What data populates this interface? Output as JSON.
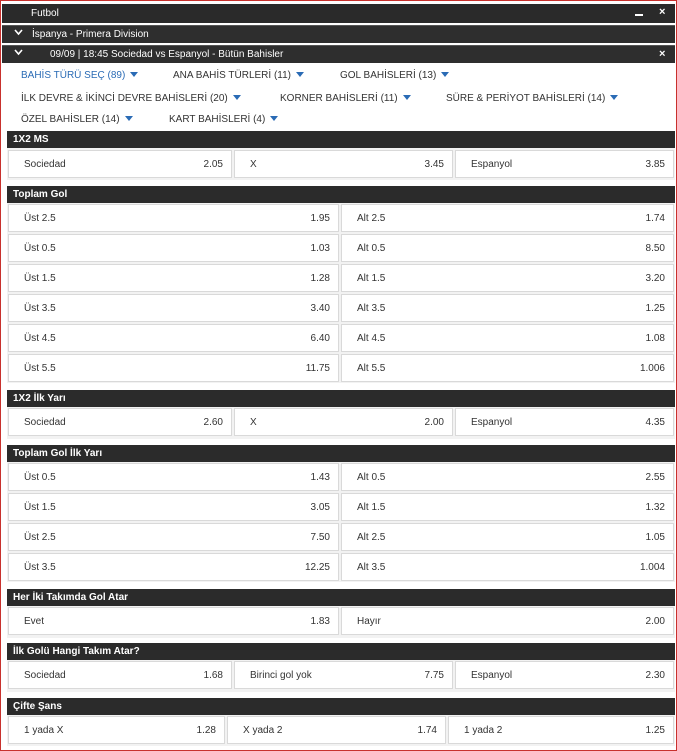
{
  "topbar": {
    "title": "Futbol",
    "minimize": "−",
    "close": "×"
  },
  "league": {
    "label": "İspanya - Primera Division"
  },
  "match": {
    "label": "09/09 | 18:45 Sociedad vs Espanyol - Bütün Bahisler",
    "close": "×"
  },
  "tabs": [
    {
      "label": "BAHİS TÜRÜ SEÇ (89)",
      "active": true
    },
    {
      "label": "ANA BAHİS TÜRLERİ (11)"
    },
    {
      "label": "GOL BAHİSLERİ (13)"
    },
    {
      "label": "İLK DEVRE & İKİNCİ DEVRE BAHİSLERİ (20)"
    },
    {
      "label": "KORNER BAHİSLERİ (11)"
    },
    {
      "label": "SÜRE & PERİYOT BAHİSLERİ (14)"
    },
    {
      "label": "ÖZEL BAHİSLER (14)"
    },
    {
      "label": "KART BAHİSLERİ (4)"
    }
  ],
  "sections": {
    "ms": {
      "title": "1X2 MS",
      "cells": [
        {
          "label": "Sociedad",
          "odd": "2.05"
        },
        {
          "label": "X",
          "odd": "3.45"
        },
        {
          "label": "Espanyol",
          "odd": "3.85"
        }
      ]
    },
    "toplam": {
      "title": "Toplam Gol",
      "rows": [
        [
          {
            "label": "Üst 2.5",
            "odd": "1.95"
          },
          {
            "label": "Alt 2.5",
            "odd": "1.74"
          }
        ],
        [
          {
            "label": "Üst 0.5",
            "odd": "1.03"
          },
          {
            "label": "Alt 0.5",
            "odd": "8.50"
          }
        ],
        [
          {
            "label": "Üst 1.5",
            "odd": "1.28"
          },
          {
            "label": "Alt 1.5",
            "odd": "3.20"
          }
        ],
        [
          {
            "label": "Üst 3.5",
            "odd": "3.40"
          },
          {
            "label": "Alt 3.5",
            "odd": "1.25"
          }
        ],
        [
          {
            "label": "Üst 4.5",
            "odd": "6.40"
          },
          {
            "label": "Alt 4.5",
            "odd": "1.08"
          }
        ],
        [
          {
            "label": "Üst 5.5",
            "odd": "11.75"
          },
          {
            "label": "Alt 5.5",
            "odd": "1.006"
          }
        ]
      ]
    },
    "iy": {
      "title": "1X2 İlk Yarı",
      "cells": [
        {
          "label": "Sociedad",
          "odd": "2.60"
        },
        {
          "label": "X",
          "odd": "2.00"
        },
        {
          "label": "Espanyol",
          "odd": "4.35"
        }
      ]
    },
    "toplam_iy": {
      "title": "Toplam Gol İlk Yarı",
      "rows": [
        [
          {
            "label": "Üst 0.5",
            "odd": "1.43"
          },
          {
            "label": "Alt 0.5",
            "odd": "2.55"
          }
        ],
        [
          {
            "label": "Üst 1.5",
            "odd": "3.05"
          },
          {
            "label": "Alt 1.5",
            "odd": "1.32"
          }
        ],
        [
          {
            "label": "Üst 2.5",
            "odd": "7.50"
          },
          {
            "label": "Alt 2.5",
            "odd": "1.05"
          }
        ],
        [
          {
            "label": "Üst 3.5",
            "odd": "12.25"
          },
          {
            "label": "Alt 3.5",
            "odd": "1.004"
          }
        ]
      ]
    },
    "kg": {
      "title": "Her İki Takımda Gol Atar",
      "cells": [
        {
          "label": "Evet",
          "odd": "1.83"
        },
        {
          "label": "Hayır",
          "odd": "2.00"
        }
      ]
    },
    "ilkgol": {
      "title": "İlk Golü Hangi Takım Atar?",
      "cells": [
        {
          "label": "Sociedad",
          "odd": "1.68"
        },
        {
          "label": "Birinci gol yok",
          "odd": "7.75"
        },
        {
          "label": "Espanyol",
          "odd": "2.30"
        }
      ]
    },
    "cs": {
      "title": "Çifte Şans",
      "cells": [
        {
          "label": "1 yada X",
          "odd": "1.28"
        },
        {
          "label": "X yada 2",
          "odd": "1.74"
        },
        {
          "label": "1 yada 2",
          "odd": "1.25"
        }
      ]
    }
  }
}
